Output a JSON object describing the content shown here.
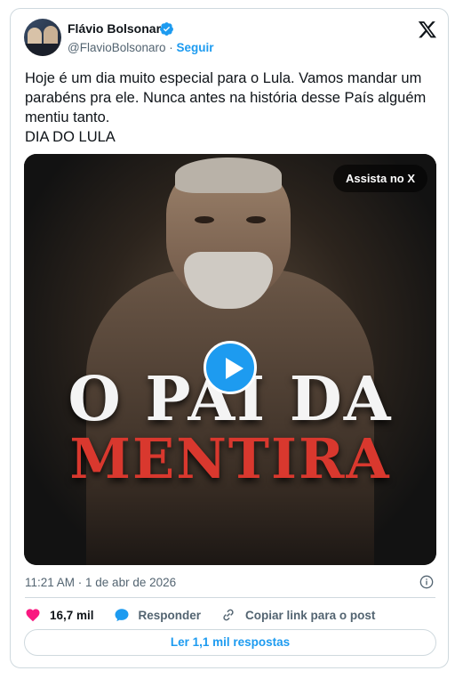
{
  "tweet": {
    "author_name": "Flávio Bolsonaro",
    "handle": "@FlavioBolsonaro",
    "separator": "·",
    "follow_label": "Seguir",
    "text": "Hoje é um dia muito especial para o Lula. Vamos mandar um parabéns pra ele. Nunca antes na história desse País alguém mentiu tanto.\nDIA DO LULA",
    "media": {
      "watch_label": "Assista no X",
      "headline_line1": "O PAI DA",
      "headline_line2": "MENTIRA"
    },
    "timestamp": "11:21 AM · 1 de abr de 2026",
    "likes": "16,7 mil",
    "reply_label": "Responder",
    "copy_link_label": "Copiar link para o post",
    "read_replies_label": "Ler 1,1 mil respostas"
  },
  "colors": {
    "accent": "#1d9bf0",
    "like": "#f91880",
    "headline_red": "#d9382e",
    "text_primary": "#0f1419",
    "text_secondary": "#536471"
  }
}
